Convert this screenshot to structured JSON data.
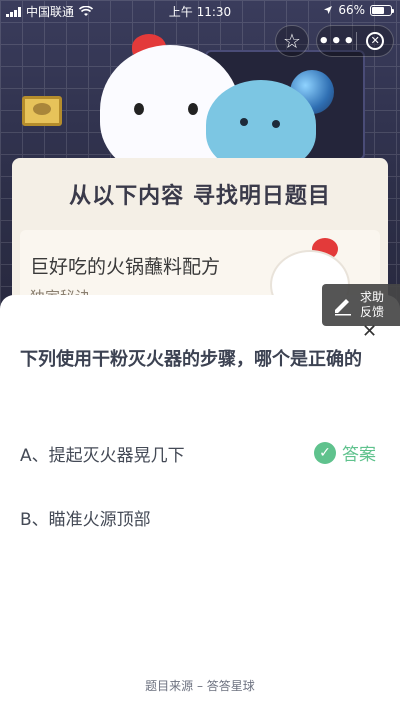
{
  "status_bar": {
    "carrier": "中国联通",
    "time": "上午 11:30",
    "battery": "66%"
  },
  "hero": {
    "title": "从以下内容 寻找明日题目",
    "recipe_title": "巨好吃的火锅蘸料配方",
    "recipe_subtitle": "独家秘诀"
  },
  "capsule": {
    "more": "•••"
  },
  "quiz": {
    "question": "下列使用干粉灭火器的步骤，哪个是正确的",
    "options": [
      {
        "label": "A、提起灭火器晃几下"
      },
      {
        "label": "B、瞄准火源顶部"
      }
    ],
    "answer_tag": "答案",
    "source": "题目来源 – 答答星球"
  },
  "feedback": {
    "line1": "求助",
    "line2": "反馈"
  },
  "colors": {
    "accent_green": "#5fc28d",
    "hero_dark": "#2b2d44"
  }
}
